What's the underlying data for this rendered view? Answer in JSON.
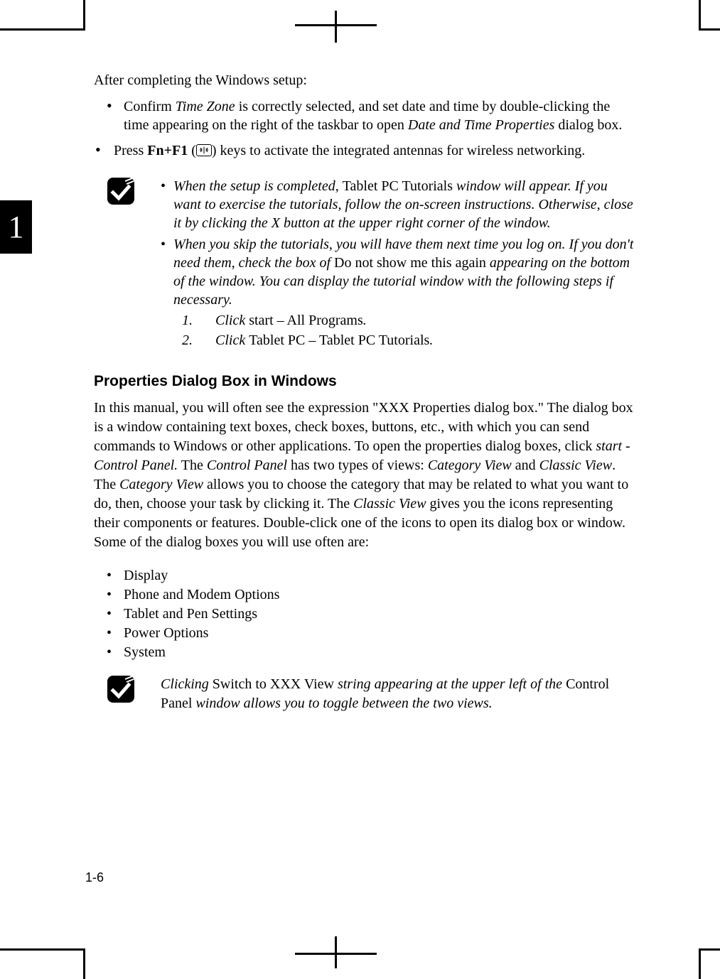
{
  "chapter_number": "1",
  "page_number": "1-6",
  "intro": "After completing the Windows setup:",
  "bullets": {
    "b1_pre": "Confirm ",
    "b1_italic1": "Time Zone",
    "b1_mid": " is correctly selected, and set date and time by double-clicking the time appearing on the right of the taskbar to open ",
    "b1_italic2": "Date and Time Properties",
    "b1_post": " dialog box.",
    "b2_pre": "Press ",
    "b2_bold": "Fn+F1",
    "b2_paren_open": " (",
    "b2_paren_close": ") keys to activate the integrated antennas for wireless networking."
  },
  "note1": {
    "n1_pre": "When the setup is completed, ",
    "n1_plain1": "Tablet PC Tutorials ",
    "n1_mid": "window will appear. If you want to exercise the tutorials, follow the on-screen instructions. Otherwise, close it by clicking the X button at the upper right corner of the window.",
    "n2_pre": "When you skip the tutorials, you will have them next time you log on. If you don't need them, check the box of ",
    "n2_plain": "Do not show me this again ",
    "n2_mid": "appearing on the bottom of the window. You can display the tutorial window with the following steps if necessary.",
    "step1_num": "1.",
    "step1_pre": "Click ",
    "step1_plain": "start – All Programs",
    "step1_post": ".",
    "step2_num": "2.",
    "step2_pre": "Click ",
    "step2_plain": "Tablet PC – Tablet PC Tutorials",
    "step2_post": "."
  },
  "heading": "Properties Dialog Box in Windows",
  "body": {
    "p1_a": "In this manual, you will often see the expression \"XXX Properties dialog box.\" The dialog box is a window containing text boxes, check boxes, buttons, etc., with which you can send commands to Windows or other applications.  To open the properties dialog boxes, click ",
    "p1_i1": "start",
    "p1_b": " - ",
    "p1_i2": "Control Panel.",
    "p1_c": " The ",
    "p1_i3": "Control Panel",
    "p1_d": " has two types of views: ",
    "p1_i4": "Category View",
    "p1_e": " and ",
    "p1_i5": "Classic View",
    "p1_f": ". The ",
    "p1_i6": "Category View",
    "p1_g": " allows you to choose the category that may be related to what you want to do, then, choose your task by clicking it. The ",
    "p1_i7": "Classic View",
    "p1_h": " gives you the icons representing their components or features. Double-click one of the icons to open its dialog box or window. Some of the dialog boxes you will use often are:"
  },
  "control_panel_items": [
    "Display",
    "Phone and Modem Options",
    "Tablet and Pen Settings",
    "Power Options",
    "System"
  ],
  "note2": {
    "pre": "Clicking ",
    "plain1": "Switch to XXX View ",
    "mid": "string appearing at the upper left of the ",
    "plain2": "Control Panel ",
    "post": "window allows you to toggle between the two views."
  }
}
